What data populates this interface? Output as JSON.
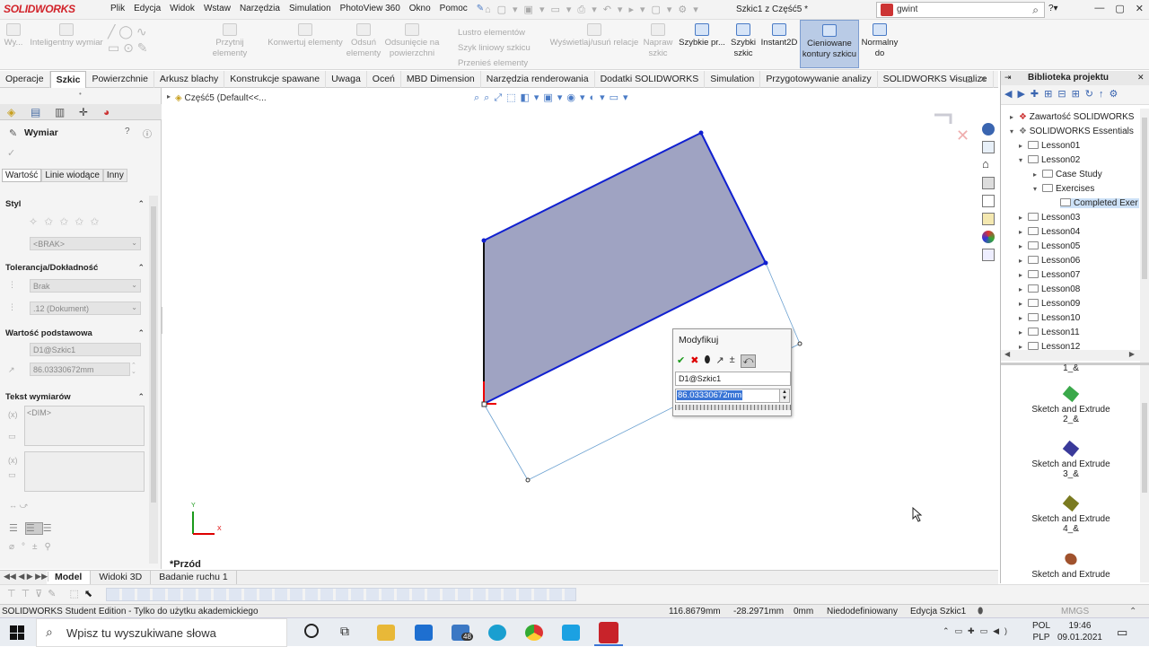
{
  "app": {
    "logo": "SOLIDWORKS",
    "doc_title": "Szkic1 z Część5 *",
    "search_value": "gwint"
  },
  "menu": [
    "Plik",
    "Edycja",
    "Widok",
    "Wstaw",
    "Narzędzia",
    "Simulation",
    "PhotoView 360",
    "Okno",
    "Pomoc"
  ],
  "ribbon": {
    "items": [
      "Wy...",
      "Inteligentny wymiar",
      "Przytnij elementy",
      "Konwertuj elementy",
      "Odsuń elementy",
      "Odsunięcie na powierzchni",
      "Lustro elementów",
      "Szyk liniowy szkicu",
      "Przenieś elementy",
      "Wyświetlaj/usuń relacje",
      "Napraw szkic",
      "Szybkie pr...",
      "Szybki szkic",
      "Instant2D",
      "Cieniowane kontury szkicu",
      "Normalny do"
    ]
  },
  "tabs": [
    "Operacje",
    "Szkic",
    "Powierzchnie",
    "Arkusz blachy",
    "Konstrukcje spawane",
    "Uwaga",
    "Oceń",
    "MBD Dimension",
    "Narzędzia renderowania",
    "Dodatki SOLIDWORKS",
    "Simulation",
    "Przygotowywanie analizy",
    "SOLIDWORKS Visualize"
  ],
  "left_panel": {
    "title": "Wymiar",
    "subtabs": [
      "Wartość",
      "Linie wiodące",
      "Inny"
    ],
    "styl": "Styl",
    "styl_value": "<BRAK>",
    "tolerance": "Tolerancja/Dokładność",
    "tol_value": "Brak",
    "precision_value": ".12 (Dokument)",
    "primary": "Wartość podstawowa",
    "primary_name": "D1@Szkic1",
    "primary_value": "86.03330672mm",
    "dimtext": "Tekst wymiarów",
    "dim_token": "<DIM>"
  },
  "viewport": {
    "breadcrumb": "Część5  (Default<<...",
    "view_name": "*Przód"
  },
  "modify": {
    "title": "Modyfikuj",
    "name": "D1@Szkic1",
    "value": "86.03330672mm"
  },
  "right_panel": {
    "title": "Biblioteka projektu",
    "tree": [
      "Zawartość SOLIDWORKS",
      "SOLIDWORKS Essentials",
      "Lesson01",
      "Lesson02",
      "Case Study",
      "Exercises",
      "Completed Exer",
      "Lesson03",
      "Lesson04",
      "Lesson05",
      "Lesson06",
      "Lesson07",
      "Lesson08",
      "Lesson09",
      "Lesson10",
      "Lesson11",
      "Lesson12"
    ],
    "library_top": "1_&",
    "library": [
      {
        "label": "Sketch and Extrude 2_&",
        "color": "#3aa84a"
      },
      {
        "label": "Sketch and Extrude 3_&",
        "color": "#3a3a9a"
      },
      {
        "label": "Sketch and Extrude 4_&",
        "color": "#7a7a20"
      },
      {
        "label": "Sketch and Extrude",
        "color": "#a0522d"
      }
    ]
  },
  "bottom_tabs": [
    "Model",
    "Widoki 3D",
    "Badanie ruchu 1"
  ],
  "status": {
    "edition": "SOLIDWORKS Student Edition - Tylko do użytku akademickiego",
    "x": "116.8679mm",
    "y": "-28.2971mm",
    "z": "0mm",
    "state": "Niedodefiniowany",
    "mode": "Edycja Szkic1",
    "units": "MMGS"
  },
  "taskbar": {
    "search": "Wpisz tu wyszukiwane słowa",
    "lang1": "POL",
    "lang2": "PLP",
    "time": "19:46",
    "date": "09.01.2021",
    "badge": "48"
  },
  "colors": {
    "sketch_fill": "#9fa3c2",
    "sketch_line": "#1020d0",
    "accent": "#d2232a"
  }
}
